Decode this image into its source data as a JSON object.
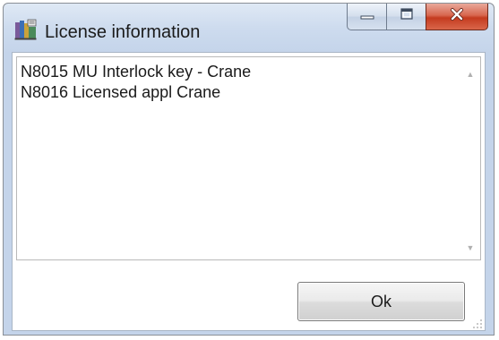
{
  "window": {
    "title": "License information",
    "icons": {
      "app": "license-app-icon",
      "minimize": "minimize-icon",
      "maximize": "maximize-icon",
      "close": "close-icon"
    }
  },
  "licenses": {
    "items": [
      "N8015 MU Interlock key - Crane",
      "N8016 Licensed appl Crane"
    ]
  },
  "actions": {
    "ok_label": "Ok"
  },
  "colors": {
    "title_bar": "#cddbee",
    "close_button": "#c43b1f",
    "text": "#1a1a1a"
  }
}
